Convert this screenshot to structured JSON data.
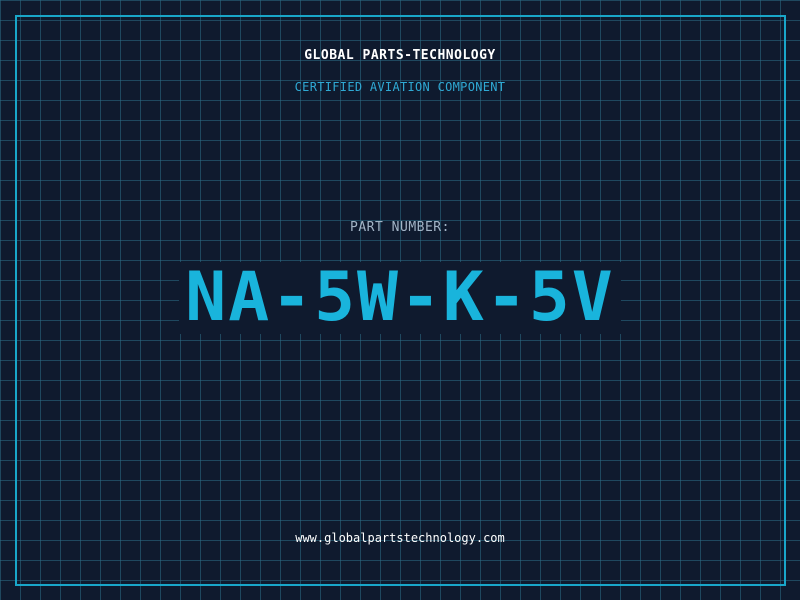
{
  "brand": {
    "company_name": "GLOBAL PARTS-TECHNOLOGY",
    "tagline": "CERTIFIED AVIATION COMPONENT"
  },
  "part": {
    "label": "PART NUMBER:",
    "number": "NA-5W-K-5V"
  },
  "footer": {
    "website": "www.globalpartstechnology.com"
  },
  "colors": {
    "background": "#0f1a2e",
    "grid": "#2c6e87",
    "accent": "#19b4dc",
    "frame": "#19a6c9",
    "label": "#a3b4c6",
    "text": "#ffffff"
  }
}
